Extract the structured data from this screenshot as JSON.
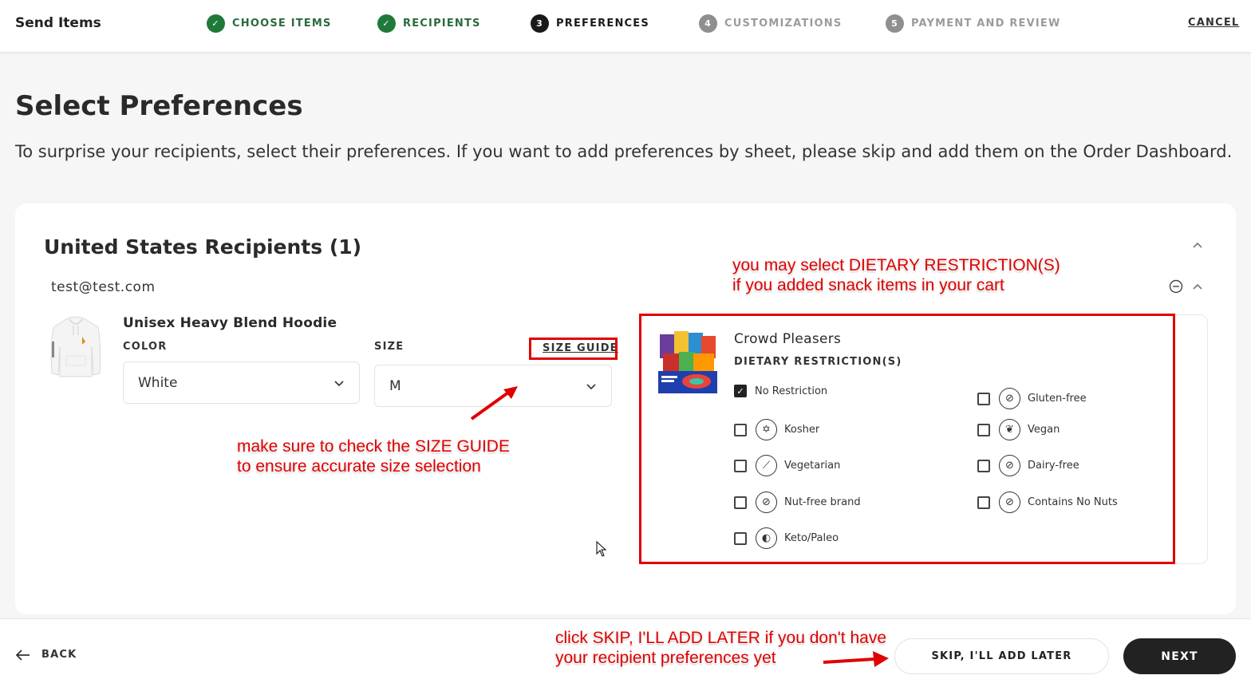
{
  "header": {
    "app_title": "Send Items",
    "steps": [
      {
        "num": "✓",
        "label": "CHOOSE ITEMS",
        "state": "done"
      },
      {
        "num": "✓",
        "label": "RECIPIENTS",
        "state": "done"
      },
      {
        "num": "3",
        "label": "PREFERENCES",
        "state": "active"
      },
      {
        "num": "4",
        "label": "CUSTOMIZATIONS",
        "state": "todo"
      },
      {
        "num": "5",
        "label": "PAYMENT AND REVIEW",
        "state": "todo"
      }
    ],
    "cancel_label": "CANCEL"
  },
  "page": {
    "title": "Select Preferences",
    "description": "To surprise your recipients, select their preferences. If you want to add preferences by sheet, please skip and add them on the Order Dashboard."
  },
  "recipients_section": {
    "title": "United States Recipients (1)",
    "email": "test@test.com",
    "product": {
      "name": "Unisex Heavy Blend Hoodie",
      "color_label": "COLOR",
      "color_value": "White",
      "size_label": "SIZE",
      "size_value": "M",
      "size_guide_label": "SIZE GUIDE"
    },
    "snack": {
      "name": "Crowd Pleasers",
      "dietary_label": "DIETARY RESTRICTION(S)",
      "options": [
        {
          "label": "No Restriction",
          "checked": true,
          "icon": ""
        },
        {
          "label": "Gluten-free",
          "checked": false,
          "icon": "gluten-free-icon"
        },
        {
          "label": "Kosher",
          "checked": false,
          "icon": "kosher-star-icon"
        },
        {
          "label": "Vegan",
          "checked": false,
          "icon": "vegan-leaf-icon"
        },
        {
          "label": "Vegetarian",
          "checked": false,
          "icon": "vegetarian-carrot-icon"
        },
        {
          "label": "Dairy-free",
          "checked": false,
          "icon": "dairy-free-icon"
        },
        {
          "label": "Nut-free brand",
          "checked": false,
          "icon": "nut-free-icon"
        },
        {
          "label": "Contains No Nuts",
          "checked": false,
          "icon": "no-nuts-icon"
        },
        {
          "label": "Keto/Paleo",
          "checked": false,
          "icon": "keto-avocado-icon"
        }
      ]
    }
  },
  "annotations": {
    "dietary_note_line1": "you may select DIETARY RESTRICTION(S)",
    "dietary_note_line2": "if you added snack items in your cart",
    "size_note_line1": "make sure to check the SIZE GUIDE",
    "size_note_line2": "to ensure accurate size selection",
    "skip_note_line1": "click SKIP, I'LL ADD LATER if you don't have",
    "skip_note_line2": "your recipient preferences yet"
  },
  "footer": {
    "back_label": "BACK",
    "skip_label": "SKIP, I'LL ADD LATER",
    "next_label": "NEXT"
  },
  "colors": {
    "done_step": "#1f7a3a",
    "annotation_red": "#e00000",
    "primary_button": "#222222"
  }
}
